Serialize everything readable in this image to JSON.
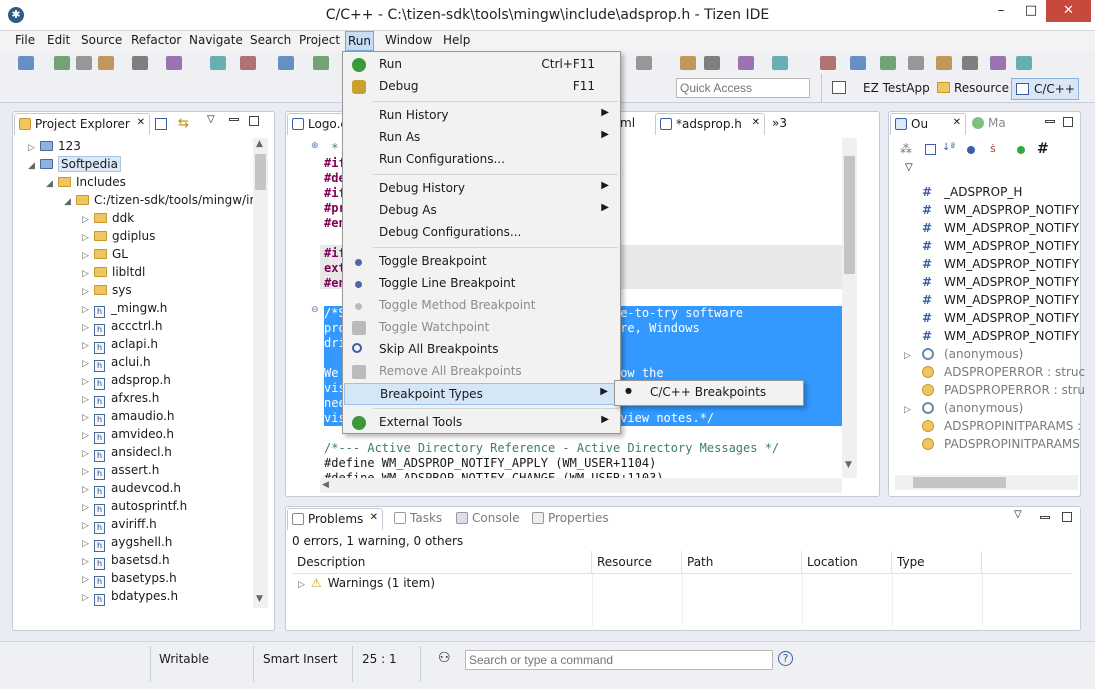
{
  "window": {
    "title": "C/C++ - C:\\tizen-sdk\\tools\\mingw\\include\\adsprop.h - Tizen IDE",
    "minimize": "–",
    "maximize": "□",
    "close": "✕"
  },
  "menubar": [
    "File",
    "Edit",
    "Source",
    "Refactor",
    "Navigate",
    "Search",
    "Project",
    "Run",
    "Window",
    "Help"
  ],
  "toolbar": {
    "quick_access_placeholder": "Quick Access",
    "perspectives": [
      "EZ TestApp",
      "Resource",
      "C/C++"
    ]
  },
  "project_explorer": {
    "tab": "Project Explorer",
    "items": [
      {
        "label": "123",
        "depth": 0,
        "kind": "project",
        "twisty": "▷"
      },
      {
        "label": "Softpedia",
        "depth": 0,
        "kind": "project",
        "twisty": "◢"
      },
      {
        "label": "Includes",
        "depth": 1,
        "kind": "folder",
        "twisty": "◢"
      },
      {
        "label": "C:/tizen-sdk/tools/mingw/ir",
        "depth": 2,
        "kind": "folder",
        "twisty": "◢"
      },
      {
        "label": "ddk",
        "depth": 3,
        "kind": "folder",
        "twisty": "▷"
      },
      {
        "label": "gdiplus",
        "depth": 3,
        "kind": "folder",
        "twisty": "▷"
      },
      {
        "label": "GL",
        "depth": 3,
        "kind": "folder",
        "twisty": "▷"
      },
      {
        "label": "libltdl",
        "depth": 3,
        "kind": "folder",
        "twisty": "▷"
      },
      {
        "label": "sys",
        "depth": 3,
        "kind": "folder",
        "twisty": "▷"
      },
      {
        "label": "_mingw.h",
        "depth": 3,
        "kind": "file",
        "twisty": "▷"
      },
      {
        "label": "accctrl.h",
        "depth": 3,
        "kind": "file",
        "twisty": "▷"
      },
      {
        "label": "aclapi.h",
        "depth": 3,
        "kind": "file",
        "twisty": "▷"
      },
      {
        "label": "aclui.h",
        "depth": 3,
        "kind": "file",
        "twisty": "▷"
      },
      {
        "label": "adsprop.h",
        "depth": 3,
        "kind": "file",
        "twisty": "▷"
      },
      {
        "label": "afxres.h",
        "depth": 3,
        "kind": "file",
        "twisty": "▷"
      },
      {
        "label": "amaudio.h",
        "depth": 3,
        "kind": "file",
        "twisty": "▷"
      },
      {
        "label": "amvideo.h",
        "depth": 3,
        "kind": "file",
        "twisty": "▷"
      },
      {
        "label": "ansidecl.h",
        "depth": 3,
        "kind": "file",
        "twisty": "▷"
      },
      {
        "label": "assert.h",
        "depth": 3,
        "kind": "file",
        "twisty": "▷"
      },
      {
        "label": "audevcod.h",
        "depth": 3,
        "kind": "file",
        "twisty": "▷"
      },
      {
        "label": "autosprintf.h",
        "depth": 3,
        "kind": "file",
        "twisty": "▷"
      },
      {
        "label": "aviriff.h",
        "depth": 3,
        "kind": "file",
        "twisty": "▷"
      },
      {
        "label": "aygshell.h",
        "depth": 3,
        "kind": "file",
        "twisty": "▷"
      },
      {
        "label": "basetsd.h",
        "depth": 3,
        "kind": "file",
        "twisty": "▷"
      },
      {
        "label": "basetyps.h",
        "depth": 3,
        "kind": "file",
        "twisty": "▷"
      },
      {
        "label": "bdatypes.h",
        "depth": 3,
        "kind": "file",
        "twisty": "▷"
      }
    ]
  },
  "editor": {
    "tabs": [
      "Logo.c",
      "ml",
      "*adsprop.h",
      "»3"
    ],
    "lines": [
      {
        "t": " * ",
        "cls": "cm"
      },
      {
        "t": "#if",
        "cls": "kw"
      },
      {
        "t": "#de",
        "cls": "kw"
      },
      {
        "t": "#if",
        "cls": "kw"
      },
      {
        "t": "#pr",
        "cls": "kw"
      },
      {
        "t": "#en",
        "cls": "kw"
      },
      {
        "t": "",
        "cls": ""
      },
      {
        "t": "#if",
        "cls": "kw"
      },
      {
        "t": "ext",
        "cls": "kw"
      },
      {
        "t": "#en",
        "cls": "kw"
      },
      {
        "t": "",
        "cls": ""
      },
      {
        "t": "/*S                          free and free-to-try software",
        "cls": "sel"
      },
      {
        "t": "pro                          , Mac software, Windows",
        "cls": "sel"
      },
      {
        "t": "dri                          icles.",
        "cls": "sel"
      },
      {
        "t": "",
        "cls": "sel"
      },
      {
        "t": "We                           order to allow the",
        "cls": "sel"
      },
      {
        "t": "vis",
        "cls": "sel"
      },
      {
        "t": "nee",
        "cls": "sel"
      },
      {
        "t": "vis                          ation and review notes.*/",
        "cls": "sel"
      },
      {
        "t": "",
        "cls": ""
      },
      {
        "t": "/*--- Active Directory Reference - Active Directory Messages */",
        "cls": "cm"
      },
      {
        "t": "#define WM_ADSPROP_NOTIFY_APPLY (WM_USER+1104)",
        "cls": ""
      },
      {
        "t": "#define WM_ADSPROP_NOTIFY_CHANGE (WM_USER+1103)",
        "cls": ""
      }
    ]
  },
  "run_menu": {
    "items": [
      {
        "label": "Run",
        "shortcut": "Ctrl+F11",
        "icon": "run-icon",
        "state": "normal"
      },
      {
        "label": "Debug",
        "shortcut": "F11",
        "icon": "debug-icon",
        "state": "normal"
      },
      {
        "sep": true
      },
      {
        "label": "Run History",
        "arrow": "▶",
        "state": "normal"
      },
      {
        "label": "Run As",
        "arrow": "▶",
        "state": "normal"
      },
      {
        "label": "Run Configurations...",
        "state": "normal"
      },
      {
        "sep": true
      },
      {
        "label": "Debug History",
        "arrow": "▶",
        "state": "normal"
      },
      {
        "label": "Debug As",
        "arrow": "▶",
        "state": "normal"
      },
      {
        "label": "Debug Configurations...",
        "state": "normal"
      },
      {
        "sep": true
      },
      {
        "label": "Toggle Breakpoint",
        "icon": "breakpoint-icon",
        "state": "normal"
      },
      {
        "label": "Toggle Line Breakpoint",
        "icon": "breakpoint-icon",
        "state": "normal"
      },
      {
        "label": "Toggle Method Breakpoint",
        "icon": "breakpoint-icon",
        "state": "disabled"
      },
      {
        "label": "Toggle Watchpoint",
        "icon": "watchpoint-icon",
        "state": "disabled"
      },
      {
        "label": "Skip All Breakpoints",
        "icon": "skip-breakpoints-icon",
        "state": "normal"
      },
      {
        "label": "Remove All Breakpoints",
        "icon": "remove-breakpoints-icon",
        "state": "disabled"
      },
      {
        "label": "Breakpoint Types",
        "arrow": "▶",
        "state": "highlighted"
      },
      {
        "sep": true
      },
      {
        "label": "External Tools",
        "arrow": "▶",
        "icon": "external-tools-icon",
        "state": "normal"
      }
    ]
  },
  "submenu": {
    "label": "C/C++ Breakpoints",
    "bullet": "●"
  },
  "outline": {
    "tabs": [
      "Ou",
      "Ma"
    ],
    "items": [
      {
        "label": "_ADSPROP_H",
        "kind": "macro",
        "twisty": ""
      },
      {
        "label": "WM_ADSPROP_NOTIFY",
        "kind": "macro",
        "twisty": ""
      },
      {
        "label": "WM_ADSPROP_NOTIFY",
        "kind": "macro",
        "twisty": ""
      },
      {
        "label": "WM_ADSPROP_NOTIFY",
        "kind": "macro",
        "twisty": ""
      },
      {
        "label": "WM_ADSPROP_NOTIFY",
        "kind": "macro",
        "twisty": ""
      },
      {
        "label": "WM_ADSPROP_NOTIFY",
        "kind": "macro",
        "twisty": ""
      },
      {
        "label": "WM_ADSPROP_NOTIFY",
        "kind": "macro",
        "twisty": ""
      },
      {
        "label": "WM_ADSPROP_NOTIFY",
        "kind": "macro",
        "twisty": ""
      },
      {
        "label": "WM_ADSPROP_NOTIFY",
        "kind": "macro",
        "twisty": ""
      },
      {
        "label": "(anonymous)",
        "kind": "struct",
        "twisty": "▷"
      },
      {
        "label": "ADSPROPERROR : struc",
        "kind": "typedef",
        "twisty": ""
      },
      {
        "label": "PADSPROPERROR : stru",
        "kind": "typedef",
        "twisty": ""
      },
      {
        "label": "(anonymous)",
        "kind": "struct",
        "twisty": "▷"
      },
      {
        "label": "ADSPROPINITPARAMS :",
        "kind": "typedef",
        "twisty": ""
      },
      {
        "label": "PADSPROPINITPARAMS",
        "kind": "typedef",
        "twisty": ""
      }
    ]
  },
  "bottom": {
    "tabs": [
      "Problems",
      "Tasks",
      "Console",
      "Properties"
    ],
    "summary": "0 errors, 1 warning, 0 others",
    "columns": [
      "Description",
      "Resource",
      "Path",
      "Location",
      "Type"
    ],
    "rows": [
      {
        "label": "Warnings (1 item)",
        "twisty": "▷",
        "icon": "warning-icon"
      }
    ]
  },
  "status": {
    "writable": "Writable",
    "insert": "Smart Insert",
    "position": "25 : 1",
    "command_placeholder": "Search or type a command",
    "help": "?"
  },
  "colors": {
    "accent": "#3399ff",
    "menu_highlight": "#d5e6f7",
    "folder": "#f0c660"
  }
}
